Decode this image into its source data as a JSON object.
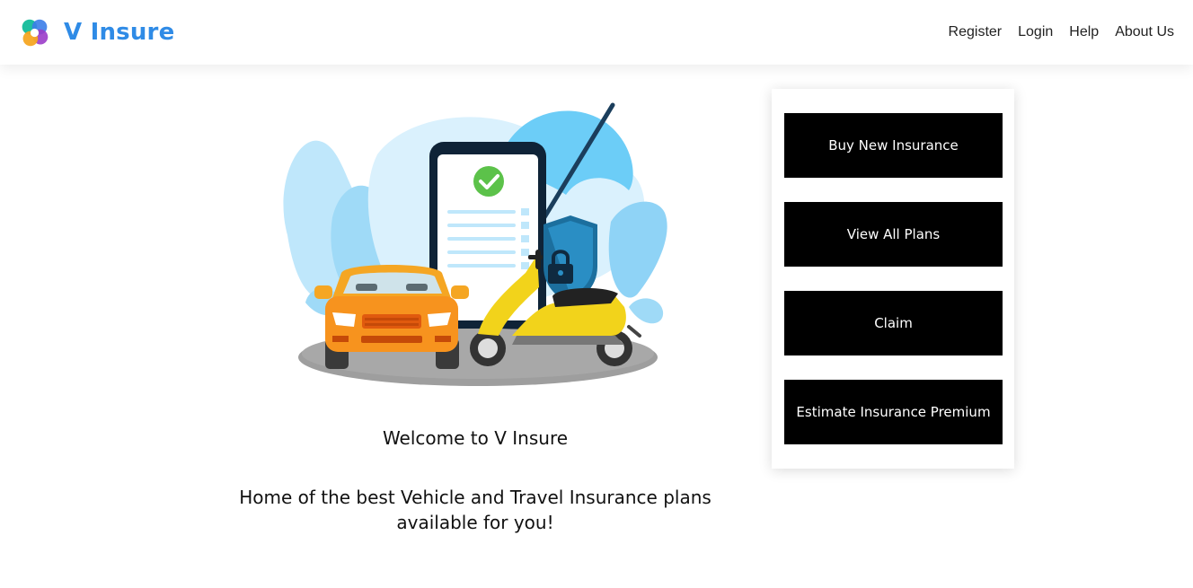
{
  "header": {
    "brand": {
      "name": "V Insure",
      "logo_icon": "swirl-logo-icon"
    },
    "nav": [
      "Register",
      "Login",
      "Help",
      "About Us"
    ]
  },
  "hero": {
    "illustration_icon": "vehicle-insurance-illustration",
    "welcome": "Welcome to V Insure",
    "tagline": "Home of the best Vehicle and Travel Insurance plans available for you!"
  },
  "actions": {
    "buy": "Buy New Insurance",
    "plans": "View All Plans",
    "claim": "Claim",
    "estimate": "Estimate Insurance Premium"
  },
  "colors": {
    "brand": "#2f8be6",
    "button_bg": "#000000",
    "button_text": "#ffffff"
  }
}
